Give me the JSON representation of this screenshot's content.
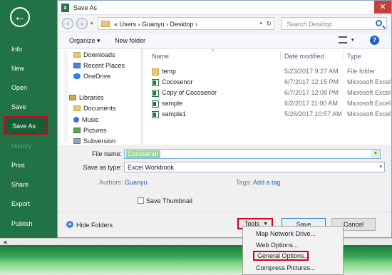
{
  "backstage": {
    "back_glyph": "←",
    "items": [
      {
        "label": "Info"
      },
      {
        "label": "New"
      },
      {
        "label": "Open"
      },
      {
        "label": "Save"
      },
      {
        "label": "Save As"
      },
      {
        "label": "History"
      },
      {
        "label": "Print"
      },
      {
        "label": "Share"
      },
      {
        "label": "Export"
      },
      {
        "label": "Publish"
      }
    ]
  },
  "dialog": {
    "title": "Save As",
    "app_icon_letter": "x",
    "close_glyph": "✕",
    "address": {
      "path": "«  Users  ›  Guanyu  ›  Desktop  ›",
      "search_placeholder": "Search Desktop"
    },
    "toolbar": {
      "organize": "Organize ▾",
      "new_folder": "New folder",
      "help": "?"
    },
    "nav": [
      {
        "label": "Downloads",
        "icon": "folder"
      },
      {
        "label": "Recent Places",
        "icon": "blue"
      },
      {
        "label": "OneDrive",
        "icon": "cloud"
      },
      {
        "label": "Libraries",
        "icon": "lib"
      },
      {
        "label": "Documents",
        "icon": "folder"
      },
      {
        "label": "Music",
        "icon": "music"
      },
      {
        "label": "Pictures",
        "icon": "pic"
      },
      {
        "label": "Subversion",
        "icon": "svn"
      }
    ],
    "columns": {
      "name": "Name",
      "date": "Date modified",
      "type": "Type"
    },
    "files": [
      {
        "name": "temp",
        "date": "5/23/2017 9:27 AM",
        "type": "File folder",
        "icon": "folder"
      },
      {
        "name": "Cocosenor",
        "date": "6/7/2017 12:15 PM",
        "type": "Microsoft Excel",
        "icon": "excel"
      },
      {
        "name": "Copy of Cocosenor",
        "date": "6/7/2017 12:08 PM",
        "type": "Microsoft Excel",
        "icon": "excel"
      },
      {
        "name": "sample",
        "date": "6/2/2017 11:00 AM",
        "type": "Microsoft Excel",
        "icon": "excel"
      },
      {
        "name": "sample1",
        "date": "5/26/2017 10:57 AM",
        "type": "Microsoft Excel",
        "icon": "excel"
      }
    ],
    "form": {
      "file_name_label": "File name:",
      "file_name_value": "Cocosenor",
      "save_type_label": "Save as type:",
      "save_type_value": "Excel Workbook",
      "authors_label": "Authors:",
      "authors_value": "Guanyu",
      "tags_label": "Tags:",
      "tags_value": "Add a tag",
      "thumbnail_label": "Save Thumbnail"
    },
    "footer": {
      "hide_folders": "Hide Folders",
      "tools": "Tools",
      "save": "Save",
      "cancel": "Cancel"
    },
    "tools_menu": [
      {
        "label": "Map Network Drive..."
      },
      {
        "label": "Web Options..."
      },
      {
        "label": "General Options..."
      },
      {
        "label": "Compress Pictures..."
      }
    ]
  }
}
